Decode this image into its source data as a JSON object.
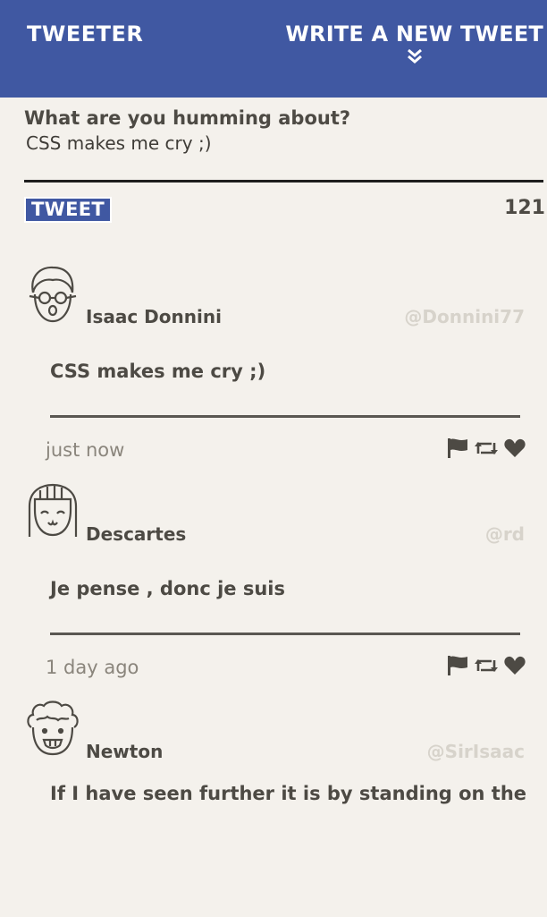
{
  "nav": {
    "brand": "TWEETER",
    "write_label": "WRITE A NEW TWEET"
  },
  "composer": {
    "label": "What are you humming about?",
    "value": "CSS makes me cry ;)",
    "button_label": "TWEET",
    "counter": "121"
  },
  "tweets": [
    {
      "name": "Isaac Donnini",
      "handle": "@Donnini77",
      "text": "CSS makes me cry ;)",
      "time": "just now"
    },
    {
      "name": "Descartes",
      "handle": "@rd",
      "text": "Je pense , donc je suis",
      "time": "1 day ago"
    },
    {
      "name": "Newton",
      "handle": "@SirIsaac",
      "text": "If I have seen further it is by standing on the",
      "time": ""
    }
  ]
}
